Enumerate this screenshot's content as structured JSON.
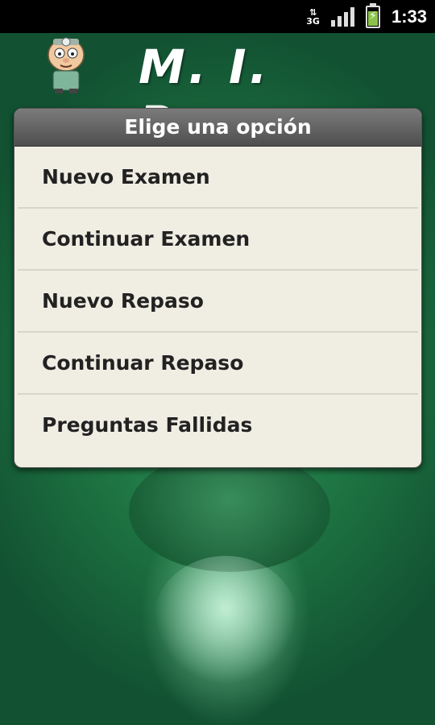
{
  "status_bar": {
    "network": "3G",
    "time": "1:33"
  },
  "header": {
    "title": "M. I. R.",
    "mascot_icon": "doctor-mascot-icon"
  },
  "dialog": {
    "title": "Elige una opción",
    "options": [
      {
        "label": "Nuevo Examen"
      },
      {
        "label": "Continuar Examen"
      },
      {
        "label": "Nuevo Repaso"
      },
      {
        "label": "Continuar Repaso"
      },
      {
        "label": "Preguntas Fallidas"
      }
    ]
  }
}
